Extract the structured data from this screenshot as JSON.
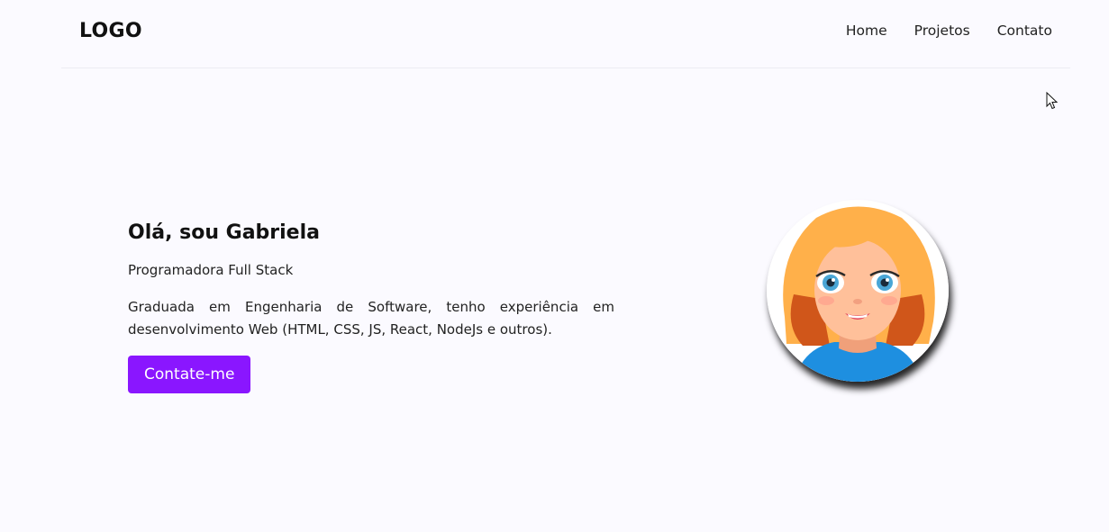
{
  "header": {
    "logo": "LOGO",
    "nav": [
      "Home",
      "Projetos",
      "Contato"
    ]
  },
  "hero": {
    "title": "Olá, sou Gabriela",
    "subtitle": "Programadora Full Stack",
    "description": "Graduada em Engenharia de Software, tenho experiência em desenvolvimento Web (HTML, CSS, JS, React, NodeJs e outros).",
    "cta_label": "Contate-me",
    "avatar_icon": "girl-avatar-icon"
  },
  "colors": {
    "accent": "#8a16ff",
    "background": "#fbfaff",
    "hair": "#ffb04a",
    "shirt": "#1e8fe0"
  }
}
